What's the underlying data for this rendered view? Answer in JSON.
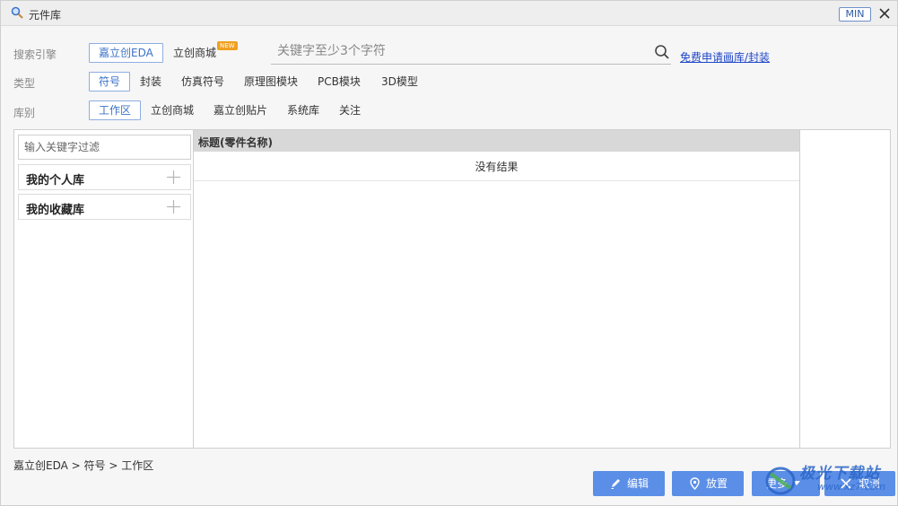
{
  "window": {
    "title": "元件库",
    "min_label": "MIN"
  },
  "engine": {
    "label": "搜索引擎",
    "options": [
      "嘉立创EDA",
      "立创商城"
    ],
    "new_badge": "NEW"
  },
  "search": {
    "placeholder": "关键字至少3个字符",
    "apply_link": "免费申请画库/封装"
  },
  "type_row": {
    "label": "类型",
    "options": [
      "符号",
      "封装",
      "仿真符号",
      "原理图模块",
      "PCB模块",
      "3D模型"
    ]
  },
  "lib_row": {
    "label": "库别",
    "options": [
      "工作区",
      "立创商城",
      "嘉立创贴片",
      "系统库",
      "关注"
    ]
  },
  "left_panel": {
    "filter_placeholder": "输入关键字过滤",
    "items": [
      "我的个人库",
      "我的收藏库"
    ]
  },
  "table": {
    "header": "标题(零件名称)",
    "empty_text": "没有结果"
  },
  "breadcrumb": "嘉立创EDA > 符号 > 工作区",
  "buttons": {
    "edit": "编辑",
    "place": "放置",
    "more": "更多",
    "cancel": "取消"
  },
  "watermark": {
    "title": "极光下载站",
    "url": "www.xz7.com"
  },
  "colors": {
    "accent": "#5b8ee6",
    "link": "#1f46c8",
    "selected_border": "#8eaee2",
    "new_badge": "#f0a020"
  },
  "icons": [
    "magnifier-icon",
    "close-icon",
    "search-icon",
    "plus-icon",
    "pencil-icon",
    "location-pin-icon",
    "caret-down-icon",
    "close-x-icon"
  ]
}
